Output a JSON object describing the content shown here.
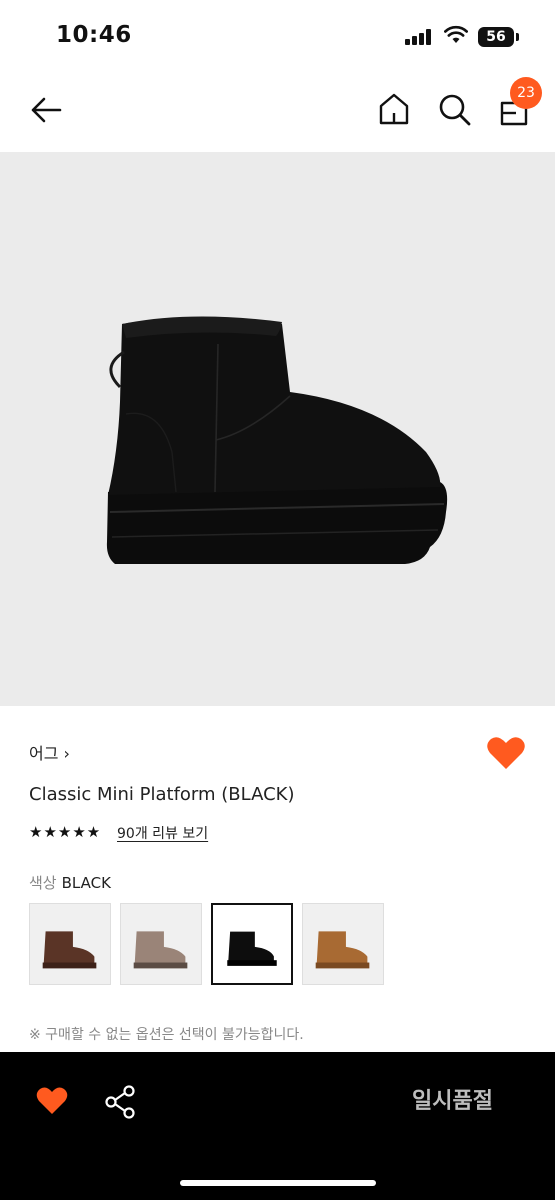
{
  "status_bar": {
    "time": "10:46",
    "battery": "56"
  },
  "nav": {
    "cart_count": "23"
  },
  "product": {
    "brand": "어그 ›",
    "name": "Classic Mini Platform (BLACK)",
    "rating_stars": "★★★★★",
    "review_link": "90개 리뷰 보기",
    "color_label": "색상",
    "color_value": "BLACK",
    "swatches": [
      {
        "color": "#5a3426",
        "selected": false
      },
      {
        "color": "#9a8478",
        "selected": false
      },
      {
        "color": "#0d0d0d",
        "selected": true
      },
      {
        "color": "#a86a33",
        "selected": false
      }
    ],
    "notice": "※ 구매할 수 없는 옵션은 선택이 불가능합니다."
  },
  "bottom_bar": {
    "status_label": "일시품절"
  },
  "colors": {
    "accent": "#ff5a1f",
    "bottom_bar_bg": "#000000",
    "hero_bg": "#ebebeb"
  },
  "icons": [
    "back-arrow-icon",
    "home-icon",
    "search-icon",
    "shopping-bag-icon",
    "heart-icon",
    "share-icon"
  ]
}
